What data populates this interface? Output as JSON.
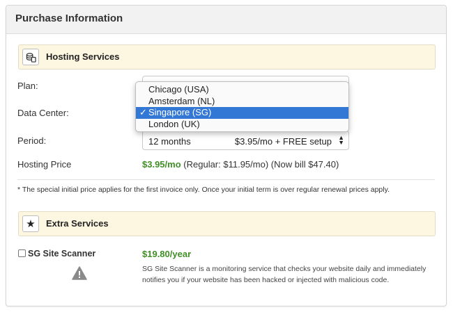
{
  "panel": {
    "title": "Purchase Information"
  },
  "hosting": {
    "section_title": "Hosting Services",
    "icon": "server-icon",
    "plan_label": "Plan:",
    "datacenter_label": "Data Center:",
    "period_label": "Period:",
    "period_value": "12 months",
    "period_price": "$3.95/mo + FREE setup",
    "hosting_price_label": "Hosting Price",
    "price_main": "$3.95/mo",
    "price_detail": "(Regular: $11.95/mo) (Now bill $47.40)"
  },
  "datacenter_dropdown": {
    "options": [
      "Chicago (USA)",
      "Amsterdam (NL)",
      "Singapore (SG)",
      "London (UK)"
    ],
    "selected": "Singapore (SG)",
    "check": "✓"
  },
  "note": "* The special initial price applies for the first invoice only. Once your initial term is over regular renewal prices apply.",
  "extra": {
    "section_title": "Extra Services",
    "icon": "star-icon",
    "scanner_name": "SG Site Scanner",
    "scanner_price": "$19.80/year",
    "scanner_desc": "SG Site Scanner is a monitoring service that checks your website daily and immediately notifies you if your website has been hacked or injected with malicious code.",
    "warning_icon": "warning-icon"
  },
  "colors": {
    "accent_green": "#3f8f24",
    "selection_blue": "#3478d6",
    "section_bg": "#fdf7e1"
  }
}
